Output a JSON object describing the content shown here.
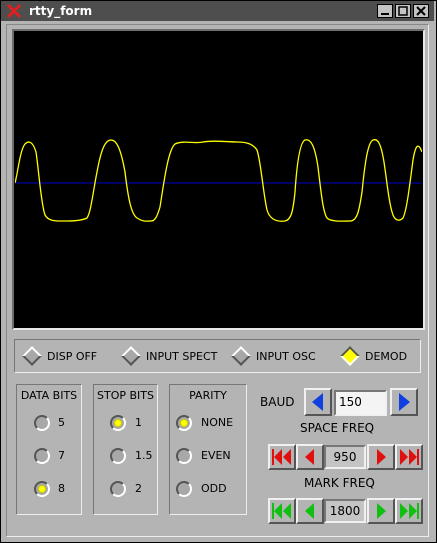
{
  "window": {
    "title": "rtty_form"
  },
  "modes": [
    {
      "label": "DISP OFF",
      "selected": false
    },
    {
      "label": "INPUT SPECT",
      "selected": false
    },
    {
      "label": "INPUT OSC",
      "selected": false
    },
    {
      "label": "DEMOD",
      "selected": true
    }
  ],
  "data_bits": {
    "title": "DATA BITS",
    "options": [
      "5",
      "7",
      "8"
    ],
    "selected": "8"
  },
  "stop_bits": {
    "title": "STOP BITS",
    "options": [
      "1",
      "1.5",
      "2"
    ],
    "selected": "1"
  },
  "parity": {
    "title": "PARITY",
    "options": [
      "NONE",
      "EVEN",
      "ODD"
    ],
    "selected": "NONE"
  },
  "baud": {
    "label": "BAUD",
    "value": "150"
  },
  "space_freq": {
    "label": "SPACE FREQ",
    "value": "950"
  },
  "mark_freq": {
    "label": "MARK FREQ",
    "value": "1800"
  },
  "colors": {
    "trace": "#ffff00",
    "baseline": "#0000cc",
    "scope_bg": "#000000",
    "blue_arrow": "#1040e0",
    "red_arrow": "#e01010",
    "green_arrow": "#10c010"
  }
}
